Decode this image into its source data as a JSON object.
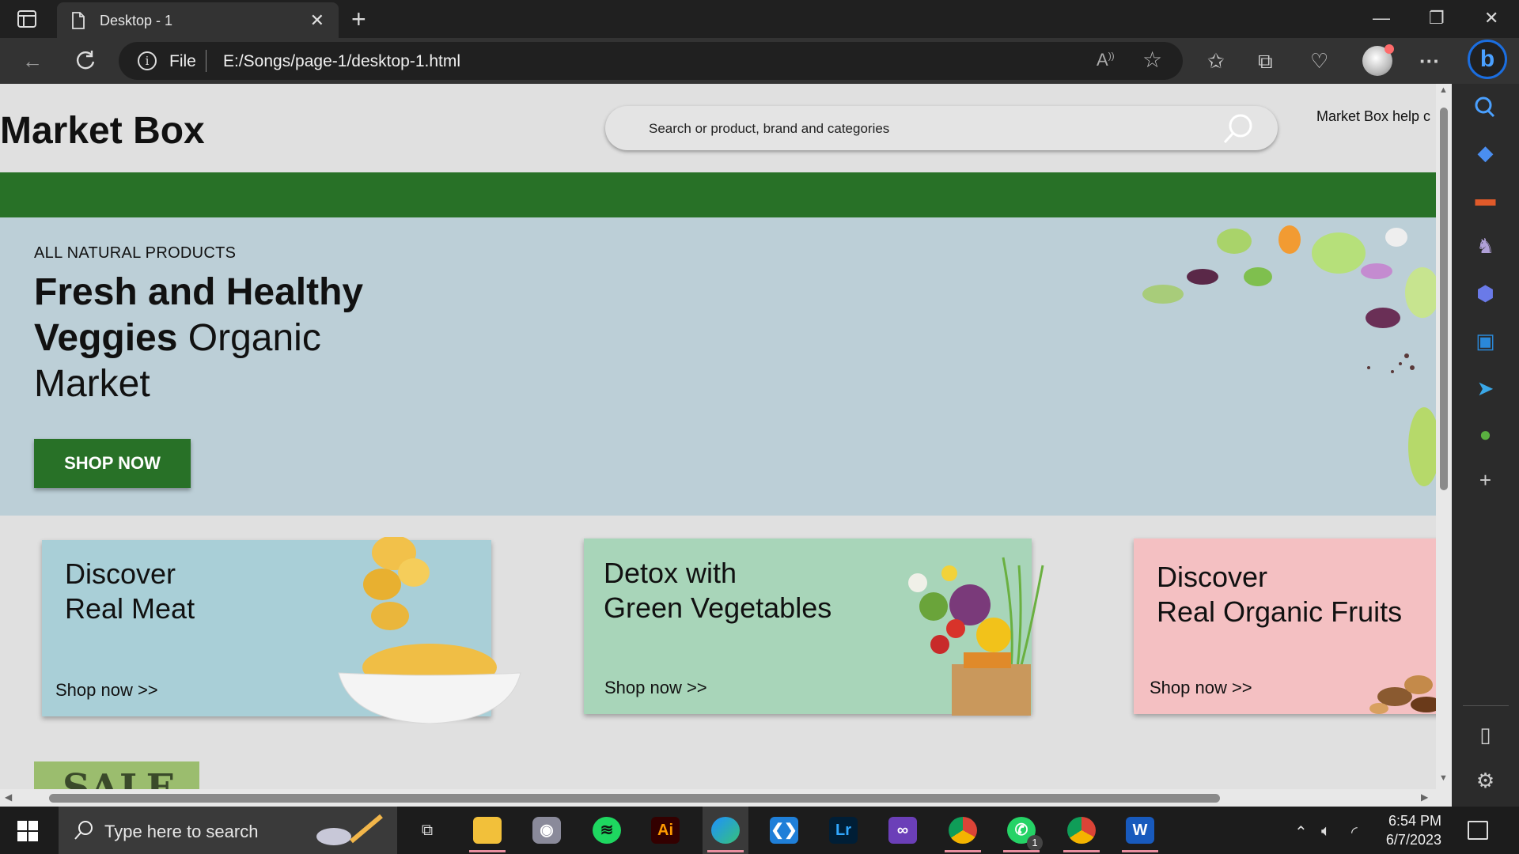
{
  "browser": {
    "tab_title": "Desktop - 1",
    "tab_close": "✕",
    "new_tab": "+",
    "address_scheme": "File",
    "address_url": "E:/Songs/page-1/desktop-1.html",
    "window_controls": {
      "minimize": "—",
      "maximize": "❐",
      "close": "✕"
    },
    "more": "···"
  },
  "page": {
    "logo": "Market Box",
    "search_placeholder": "Search or product, brand and categories",
    "help_link": "Market Box help c",
    "hero": {
      "kicker": "ALL NATURAL PRODUCTS",
      "headline_bold": "Fresh and Healthy Veggies",
      "headline_rest": " Organic Market",
      "cta": "SHOP NOW"
    },
    "cards": [
      {
        "title_line1": "Discover",
        "title_line2": "Real Meat",
        "link": "Shop now >>",
        "color": "#a9cfd7"
      },
      {
        "title_line1": "Detox with",
        "title_line2": "Green Vegetables",
        "link": "Shop now >>",
        "color": "#a8d5b9"
      },
      {
        "title_line1": "Discover",
        "title_line2": "Real Organic Fruits",
        "link": "Shop now >>",
        "color": "#f4c0c2"
      }
    ],
    "sale_banner": "SALE",
    "brand_green": "#287127",
    "hero_bg": "#bccfd7"
  },
  "sidebar": {
    "icons": [
      "search-icon",
      "tag-icon",
      "briefcase-icon",
      "chess-icon",
      "office-icon",
      "outlook-icon",
      "send-icon",
      "tree-icon",
      "add-icon",
      "split-screen-icon",
      "settings-icon"
    ]
  },
  "taskbar": {
    "search_placeholder": "Type here to search",
    "apps": [
      {
        "name": "task-view",
        "label": ""
      },
      {
        "name": "file-explorer",
        "label": ""
      },
      {
        "name": "camera",
        "label": ""
      },
      {
        "name": "spotify",
        "label": ""
      },
      {
        "name": "illustrator",
        "label": "Ai"
      },
      {
        "name": "edge",
        "label": ""
      },
      {
        "name": "vscode",
        "label": ""
      },
      {
        "name": "lightroom",
        "label": "Lr"
      },
      {
        "name": "visual-studio",
        "label": ""
      },
      {
        "name": "chrome",
        "label": ""
      },
      {
        "name": "whatsapp",
        "label": ""
      },
      {
        "name": "chrome-profile",
        "label": ""
      },
      {
        "name": "word",
        "label": "W"
      }
    ],
    "whatsapp_badge": "1",
    "time": "6:54 PM",
    "date": "6/7/2023"
  }
}
